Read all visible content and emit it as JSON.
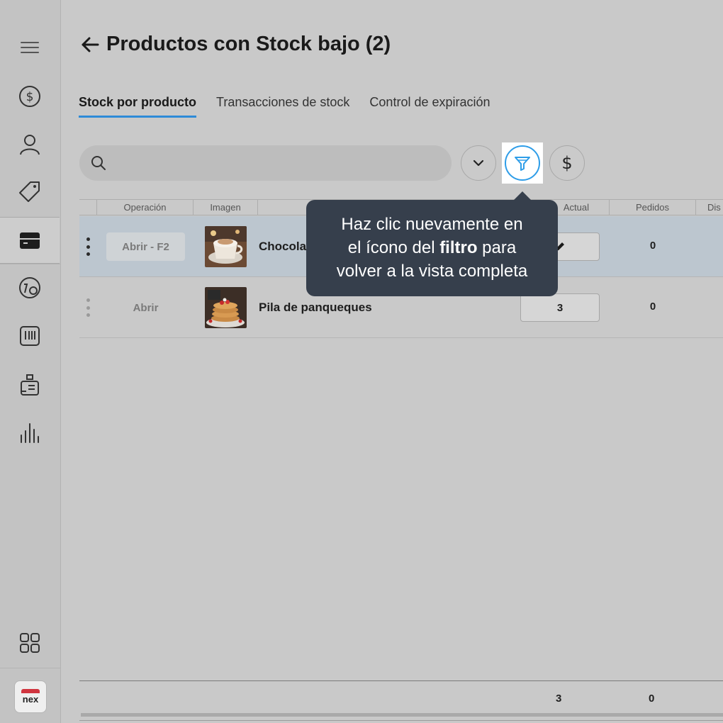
{
  "sidebar": {
    "items": [
      {
        "name": "menu-icon"
      },
      {
        "name": "dollar-circle-icon"
      },
      {
        "name": "user-icon"
      },
      {
        "name": "tag-icon"
      },
      {
        "name": "box-icon",
        "active": true
      },
      {
        "name": "dashboard-icon"
      },
      {
        "name": "barcode-icon"
      },
      {
        "name": "register-icon"
      },
      {
        "name": "bar-chart-icon"
      },
      {
        "name": "apps-grid-icon"
      }
    ],
    "logo_text": "nex"
  },
  "header": {
    "title": "Productos con Stock bajo (2)"
  },
  "tabs": [
    {
      "label": "Stock por producto",
      "active": true
    },
    {
      "label": "Transacciones de stock",
      "active": false
    },
    {
      "label": "Control de expiración",
      "active": false
    }
  ],
  "search": {
    "placeholder": "",
    "value": ""
  },
  "table": {
    "columns": [
      "Operación",
      "Imagen",
      "",
      "Actual",
      "Pedidos",
      "Dis"
    ],
    "rows": [
      {
        "operation": "Abrir - F2",
        "image": "chocolate-drink-photo",
        "name": "Chocolate",
        "actual": "",
        "pedidos": "0",
        "selected": true
      },
      {
        "operation": "Abrir",
        "image": "pancake-stack-photo",
        "name": "Pila de panqueques",
        "actual": "3",
        "pedidos": "0",
        "selected": false
      }
    ],
    "footer": {
      "actual_total": "3",
      "pedidos_total": "0"
    }
  },
  "tooltip": {
    "line1": "Haz clic nuevamente en",
    "line2_before": "el ícono del ",
    "line2_bold": "filtro",
    "line2_after": " para",
    "line3": "volver a la vista completa"
  },
  "colors": {
    "accent": "#2e9de8",
    "tooltip_bg": "#363f4c",
    "selected_row": "#bcc6cf"
  }
}
